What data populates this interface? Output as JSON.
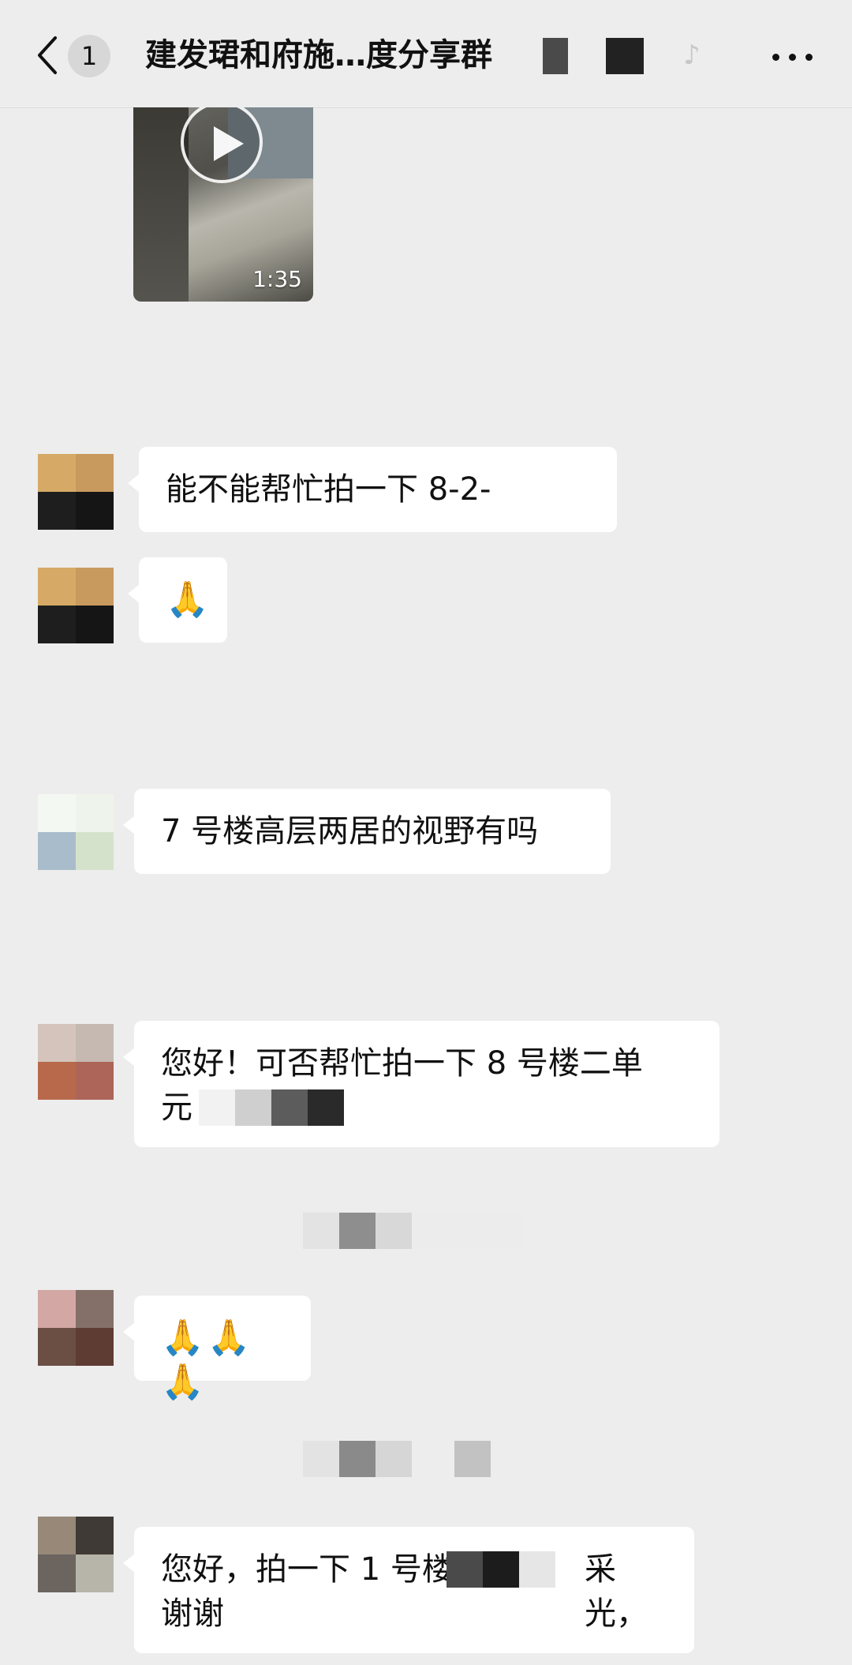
{
  "header": {
    "back_icon": "chevron-left-icon",
    "unread_count": "1",
    "title": "建发珺和府施…度分享群",
    "more_icon": "ellipsis-icon"
  },
  "messages": [
    {
      "type": "video",
      "duration": "1:35",
      "icon": "play-icon"
    },
    {
      "type": "text",
      "text": "能不能帮忙拍一下 8-2-"
    },
    {
      "type": "emoji",
      "text": "🙏"
    },
    {
      "type": "text",
      "text": "7 号楼高层两居的视野有吗"
    },
    {
      "type": "text",
      "text": "您好！可否帮忙拍一下 8 号楼二单",
      "line2": "元"
    },
    {
      "type": "emoji",
      "text": "🙏🙏🙏"
    },
    {
      "type": "text",
      "text": "您好，拍一下 1 号楼",
      "text_after": "采光，",
      "line2": "谢谢"
    }
  ]
}
